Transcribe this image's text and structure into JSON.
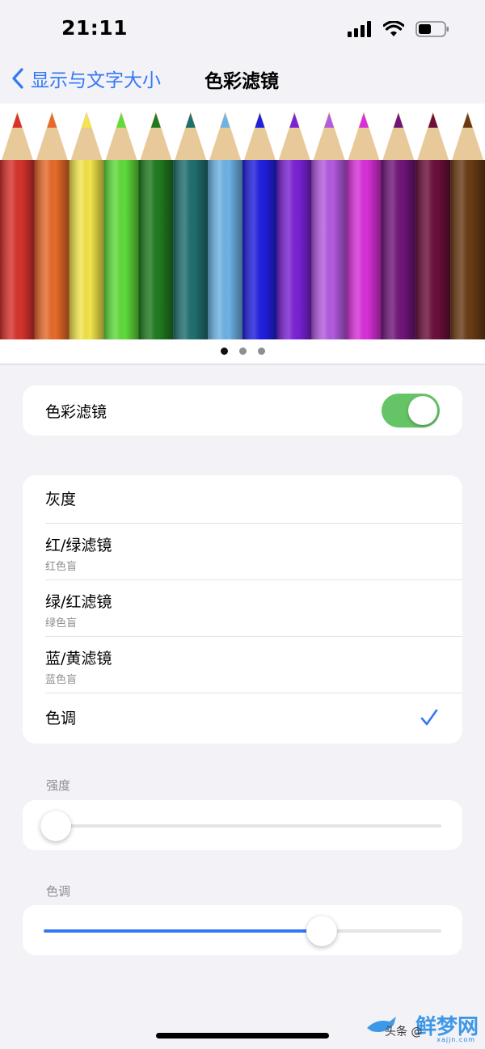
{
  "status": {
    "time": "21:11",
    "icons": [
      "cellular-signal-icon",
      "wifi-icon",
      "battery-icon"
    ],
    "battery_level": 0.5
  },
  "nav": {
    "back_label": "显示与文字大小",
    "title": "色彩滤镜"
  },
  "preview": {
    "pencil_colors": [
      "#d8322c",
      "#e86a2a",
      "#f3e54a",
      "#5fdc3a",
      "#1f7a1f",
      "#1f6f70",
      "#6db3e6",
      "#1f1fe0",
      "#7a22d6",
      "#b45be0",
      "#d92fd9",
      "#70157a",
      "#6c0f3a",
      "#6a3a14"
    ],
    "page_count": 3,
    "current_page": 1
  },
  "color_filter": {
    "label": "色彩滤镜",
    "enabled": true
  },
  "filters": [
    {
      "title": "灰度",
      "subtitle": "",
      "selected": false
    },
    {
      "title": "红/绿滤镜",
      "subtitle": "红色盲",
      "selected": false
    },
    {
      "title": "绿/红滤镜",
      "subtitle": "绿色盲",
      "selected": false
    },
    {
      "title": "蓝/黄滤镜",
      "subtitle": "蓝色盲",
      "selected": false
    },
    {
      "title": "色调",
      "subtitle": "",
      "selected": true
    }
  ],
  "intensity": {
    "label": "强度",
    "value": 0.0
  },
  "hue": {
    "label": "色调",
    "value": 0.7
  },
  "colors": {
    "accent": "#3478f6",
    "toggle_on": "#65c466",
    "background": "#f2f2f7"
  },
  "watermark": {
    "logo": "鲜梦网",
    "by": "头条 @",
    "url": "xajjn.com"
  }
}
